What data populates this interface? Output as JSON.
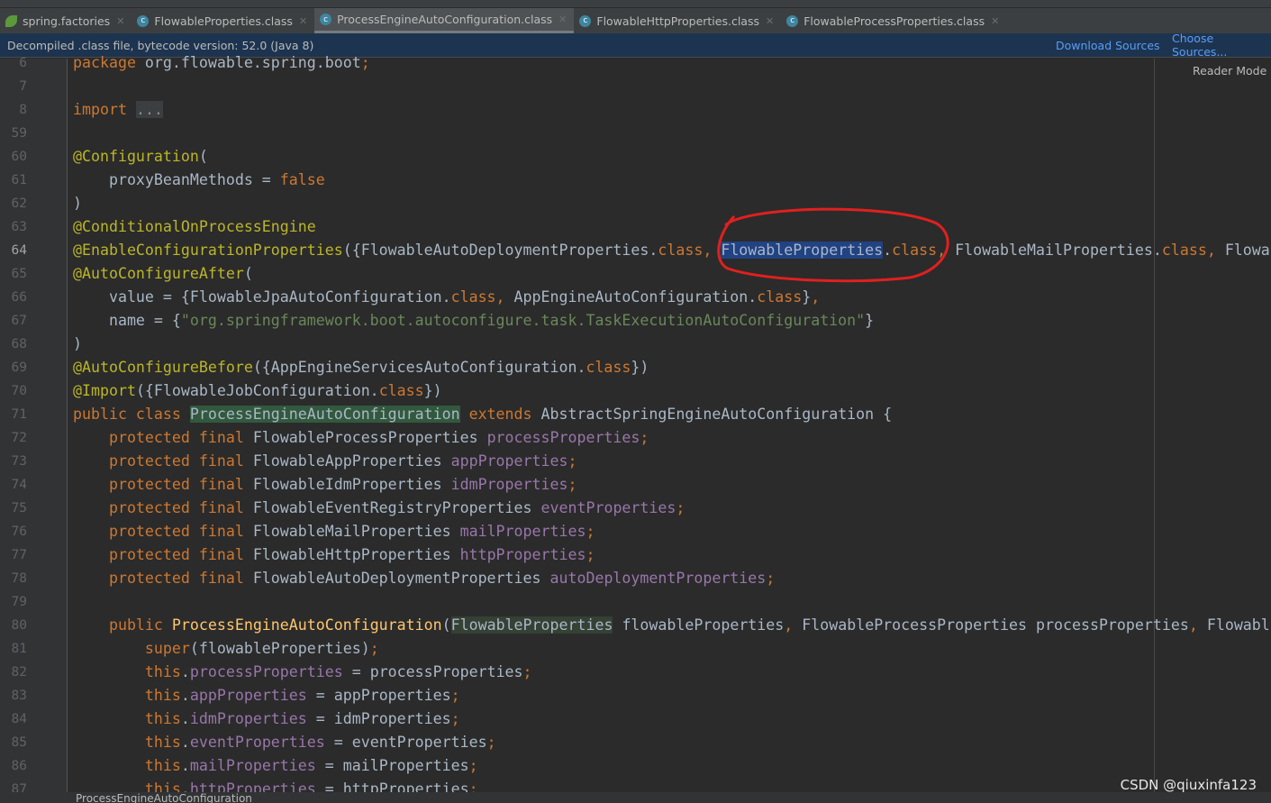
{
  "tabs": [
    {
      "label": "spring.factories",
      "icon": "spring-leaf-icon",
      "active": false
    },
    {
      "label": "FlowableProperties.class",
      "icon": "class-icon",
      "active": false
    },
    {
      "label": "ProcessEngineAutoConfiguration.class",
      "icon": "class-icon",
      "active": true
    },
    {
      "label": "FlowableHttpProperties.class",
      "icon": "class-icon",
      "active": false
    },
    {
      "label": "FlowableProcessProperties.class",
      "icon": "class-icon",
      "active": false
    }
  ],
  "banner": {
    "message": "Decompiled .class file, bytecode version: 52.0 (Java 8)",
    "download": "Download Sources",
    "choose": "Choose Sources..."
  },
  "reader_mode": "Reader Mode",
  "current_line": "64",
  "lines": [
    {
      "n": "6",
      "t": [
        [
          "k",
          "package"
        ],
        [
          "p",
          " org.flowable.spring.boot"
        ],
        [
          "k",
          ";"
        ]
      ]
    },
    {
      "n": "7",
      "t": []
    },
    {
      "n": "8",
      "t": [
        [
          "k",
          "import"
        ],
        [
          "p",
          " "
        ],
        [
          "fold",
          "..."
        ]
      ]
    },
    {
      "n": "59",
      "t": []
    },
    {
      "n": "60",
      "t": [
        [
          "a",
          "@Configuration"
        ],
        [
          "p",
          "("
        ]
      ]
    },
    {
      "n": "61",
      "t": [
        [
          "p",
          "    proxyBeanMethods = "
        ],
        [
          "k",
          "false"
        ]
      ]
    },
    {
      "n": "62",
      "t": [
        [
          "p",
          ")"
        ]
      ]
    },
    {
      "n": "63",
      "t": [
        [
          "a",
          "@ConditionalOnProcessEngine"
        ]
      ]
    },
    {
      "n": "64",
      "t": [
        [
          "a",
          "@EnableConfigurationProperties"
        ],
        [
          "p",
          "({FlowableAutoDeploymentProperties."
        ],
        [
          "k",
          "class, "
        ],
        [
          "sel",
          "FlowableProperties"
        ],
        [
          "p",
          "."
        ],
        [
          "k",
          "class, "
        ],
        [
          "p",
          "FlowableMailProperties."
        ],
        [
          "k",
          "class, "
        ],
        [
          "p",
          "Flowa"
        ]
      ]
    },
    {
      "n": "65",
      "t": [
        [
          "a",
          "@AutoConfigureAfter"
        ],
        [
          "p",
          "("
        ]
      ]
    },
    {
      "n": "66",
      "t": [
        [
          "p",
          "    value = {FlowableJpaAutoConfiguration."
        ],
        [
          "k",
          "class, "
        ],
        [
          "p",
          "AppEngineAutoConfiguration."
        ],
        [
          "k",
          "class"
        ],
        [
          "p",
          "}"
        ],
        [
          "k",
          ","
        ]
      ]
    },
    {
      "n": "67",
      "t": [
        [
          "p",
          "    name = {"
        ],
        [
          "s",
          "\"org.springframework.boot.autoconfigure.task.TaskExecutionAutoConfiguration\""
        ],
        [
          "p",
          "}"
        ]
      ]
    },
    {
      "n": "68",
      "t": [
        [
          "p",
          ")"
        ]
      ]
    },
    {
      "n": "69",
      "t": [
        [
          "a",
          "@AutoConfigureBefore"
        ],
        [
          "p",
          "({AppEngineServicesAutoConfiguration."
        ],
        [
          "k",
          "class"
        ],
        [
          "p",
          "})"
        ]
      ]
    },
    {
      "n": "70",
      "t": [
        [
          "a",
          "@Import"
        ],
        [
          "p",
          "({FlowableJobConfiguration."
        ],
        [
          "k",
          "class"
        ],
        [
          "p",
          "})"
        ]
      ]
    },
    {
      "n": "71",
      "t": [
        [
          "k",
          "public class "
        ],
        [
          "gh",
          "ProcessEngineAutoConfiguration"
        ],
        [
          "k",
          " extends "
        ],
        [
          "p",
          "AbstractSpringEngineAutoConfiguration {"
        ]
      ]
    },
    {
      "n": "72",
      "t": [
        [
          "k",
          "    protected final "
        ],
        [
          "p",
          "FlowableProcessProperties "
        ],
        [
          "f",
          "processProperties"
        ],
        [
          "k",
          ";"
        ]
      ]
    },
    {
      "n": "73",
      "t": [
        [
          "k",
          "    protected final "
        ],
        [
          "p",
          "FlowableAppProperties "
        ],
        [
          "f",
          "appProperties"
        ],
        [
          "k",
          ";"
        ]
      ]
    },
    {
      "n": "74",
      "t": [
        [
          "k",
          "    protected final "
        ],
        [
          "p",
          "FlowableIdmProperties "
        ],
        [
          "f",
          "idmProperties"
        ],
        [
          "k",
          ";"
        ]
      ]
    },
    {
      "n": "75",
      "t": [
        [
          "k",
          "    protected final "
        ],
        [
          "p",
          "FlowableEventRegistryProperties "
        ],
        [
          "f",
          "eventProperties"
        ],
        [
          "k",
          ";"
        ]
      ]
    },
    {
      "n": "76",
      "t": [
        [
          "k",
          "    protected final "
        ],
        [
          "p",
          "FlowableMailProperties "
        ],
        [
          "f",
          "mailProperties"
        ],
        [
          "k",
          ";"
        ]
      ]
    },
    {
      "n": "77",
      "t": [
        [
          "k",
          "    protected final "
        ],
        [
          "p",
          "FlowableHttpProperties "
        ],
        [
          "f",
          "httpProperties"
        ],
        [
          "k",
          ";"
        ]
      ]
    },
    {
      "n": "78",
      "t": [
        [
          "k",
          "    protected final "
        ],
        [
          "p",
          "FlowableAutoDeploymentProperties "
        ],
        [
          "f",
          "autoDeploymentProperties"
        ],
        [
          "k",
          ";"
        ]
      ]
    },
    {
      "n": "79",
      "t": []
    },
    {
      "n": "80",
      "t": [
        [
          "k",
          "    public "
        ],
        [
          "m",
          "ProcessEngineAutoConfiguration"
        ],
        [
          "p",
          "("
        ],
        [
          "ph",
          "FlowableProperties"
        ],
        [
          "p",
          " flowableProperties"
        ],
        [
          "k",
          ", "
        ],
        [
          "p",
          "FlowableProcessProperties processProperties"
        ],
        [
          "k",
          ", "
        ],
        [
          "p",
          "Flowabl"
        ]
      ]
    },
    {
      "n": "81",
      "t": [
        [
          "k",
          "        super"
        ],
        [
          "p",
          "(flowableProperties)"
        ],
        [
          "k",
          ";"
        ]
      ]
    },
    {
      "n": "82",
      "t": [
        [
          "k",
          "        this"
        ],
        [
          "p",
          "."
        ],
        [
          "f",
          "processProperties"
        ],
        [
          "p",
          " = processProperties"
        ],
        [
          "k",
          ";"
        ]
      ]
    },
    {
      "n": "83",
      "t": [
        [
          "k",
          "        this"
        ],
        [
          "p",
          "."
        ],
        [
          "f",
          "appProperties"
        ],
        [
          "p",
          " = appProperties"
        ],
        [
          "k",
          ";"
        ]
      ]
    },
    {
      "n": "84",
      "t": [
        [
          "k",
          "        this"
        ],
        [
          "p",
          "."
        ],
        [
          "f",
          "idmProperties"
        ],
        [
          "p",
          " = idmProperties"
        ],
        [
          "k",
          ";"
        ]
      ]
    },
    {
      "n": "85",
      "t": [
        [
          "k",
          "        this"
        ],
        [
          "p",
          "."
        ],
        [
          "f",
          "eventProperties"
        ],
        [
          "p",
          " = eventProperties"
        ],
        [
          "k",
          ";"
        ]
      ]
    },
    {
      "n": "86",
      "t": [
        [
          "k",
          "        this"
        ],
        [
          "p",
          "."
        ],
        [
          "f",
          "mailProperties"
        ],
        [
          "p",
          " = mailProperties"
        ],
        [
          "k",
          ";"
        ]
      ]
    },
    {
      "n": "87",
      "t": [
        [
          "k",
          "        this"
        ],
        [
          "p",
          "."
        ],
        [
          "f",
          "httpProperties"
        ],
        [
          "p",
          " = httpProperties"
        ],
        [
          "k",
          ";"
        ]
      ]
    }
  ],
  "breadcrumb": "ProcessEngineAutoConfiguration",
  "watermark": "CSDN @qiuxinfa123",
  "colors": {
    "keyword": "#cc7832",
    "annotation": "#bbb529",
    "field": "#9876aa",
    "string": "#6a8759",
    "annotation_circle": "#e0201f"
  }
}
